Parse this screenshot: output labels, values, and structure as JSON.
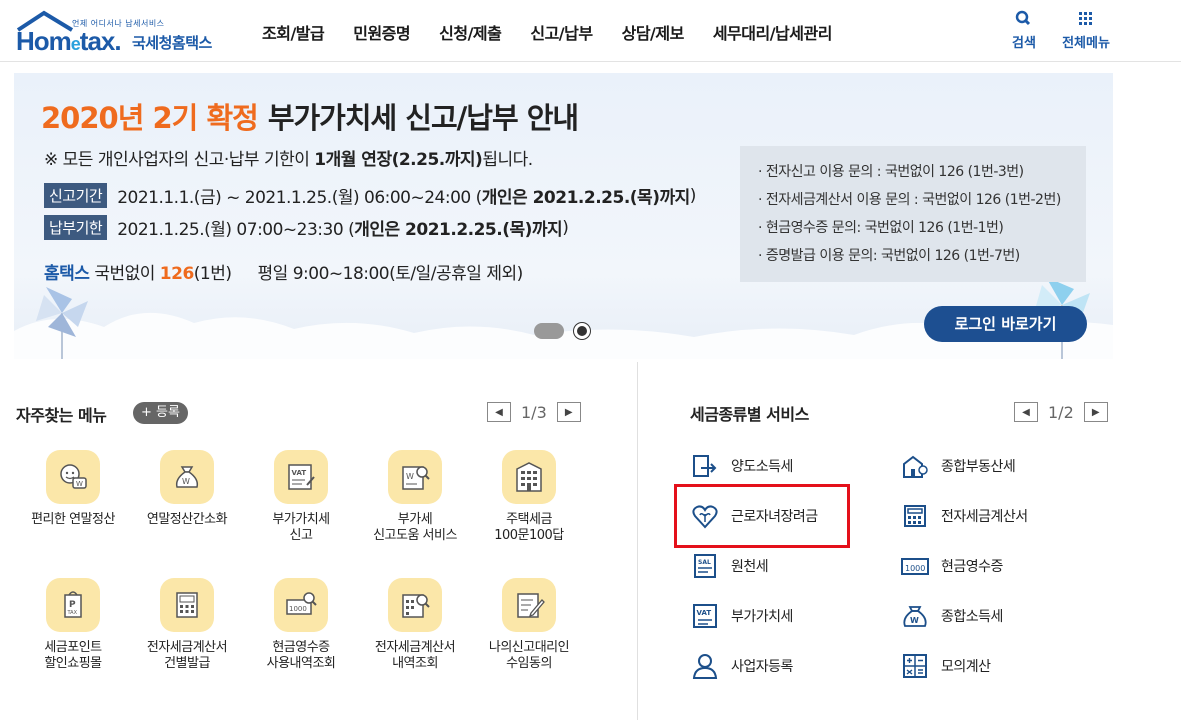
{
  "header": {
    "logo_sub": "언제 어디서나 납세서비스",
    "logo_word_a": "Hom",
    "logo_word_e": "e",
    "logo_word_b": "tax.",
    "logo_kr": "국세청홈택스",
    "nav": [
      "조회/발급",
      "민원증명",
      "신청/제출",
      "신고/납부",
      "상담/제보",
      "세무대리/납세관리"
    ],
    "search_label": "검색",
    "menu_label": "전체메뉴",
    "accent_color": "#1c5aa8"
  },
  "banner": {
    "title_orange": "2020년 2기 확정",
    "title_dark": "부가가치세 신고/납부 안내",
    "note_a": "※ 모든 개인사업자의 신고·납부 기한이 ",
    "note_b": "1개월 연장(2.25.까지)",
    "note_c": "됩니다.",
    "filing_tag": "신고기간",
    "filing_text": "2021.1.1.(금) ~ 2021.1.25.(월) 06:00~24:00 (",
    "filing_bold": "개인은 2021.2.25.(목)까지",
    "filing_end": ")",
    "payment_tag": "납부기한",
    "payment_text": "2021.1.25.(월) 07:00~23:30 (",
    "payment_bold": "개인은 2021.2.25.(목)까지",
    "payment_end": ")",
    "contact_brand": "홈택스",
    "contact_text": " 국번없이 ",
    "contact_number": "126",
    "contact_suffix": "(1번)",
    "hours": "평일 9:00~18:00(토/일/공휴일 제외)",
    "info": [
      "· 전자신고 이용 문의 : 국번없이 126 (1번-3번)",
      "· 전자세금계산서 이용 문의 : 국번없이 126 (1번-2번)",
      "· 현금영수증 문의: 국번없이 126 (1번-1번)",
      "· 증명발급 이용 문의: 국번없이 126 (1번-7번)"
    ],
    "login_button": "로그인 바로가기",
    "accent_orange": "#ef6b1e"
  },
  "favorites": {
    "title": "자주찾는 메뉴",
    "register": "+ 등록",
    "page": "1/3",
    "items": [
      {
        "label": "편리한 연말정산",
        "icon": "year-end-settlement-icon"
      },
      {
        "label": "연말정산간소화",
        "icon": "money-bag-icon"
      },
      {
        "label": "부가가치세\n신고",
        "icon": "vat-document-icon"
      },
      {
        "label": "부가세\n신고도움 서비스",
        "icon": "vat-help-icon"
      },
      {
        "label": "주택세금\n100문100답",
        "icon": "building-icon"
      },
      {
        "label": "세금포인트\n할인쇼핑몰",
        "icon": "tax-point-icon"
      },
      {
        "label": "전자세금계산서\n건별발급",
        "icon": "calculator-icon"
      },
      {
        "label": "현금영수증\n사용내역조회",
        "icon": "cash-receipt-search-icon"
      },
      {
        "label": "전자세금계산서\n내역조회",
        "icon": "invoice-search-icon"
      },
      {
        "label": "나의신고대리인\n수임동의",
        "icon": "edit-document-icon"
      }
    ]
  },
  "services": {
    "title": "세금종류별 서비스",
    "page": "1/2",
    "items": [
      {
        "label": "양도소득세",
        "icon": "transfer-income-icon"
      },
      {
        "label": "종합부동산세",
        "icon": "real-estate-icon"
      },
      {
        "label": "근로자녀장려금",
        "icon": "heart-sprout-icon"
      },
      {
        "label": "전자세금계산서",
        "icon": "e-invoice-icon"
      },
      {
        "label": "원천세",
        "icon": "withholding-icon"
      },
      {
        "label": "현금영수증",
        "icon": "cash-receipt-icon"
      },
      {
        "label": "부가가치세",
        "icon": "vat-icon"
      },
      {
        "label": "종합소득세",
        "icon": "income-tax-icon"
      },
      {
        "label": "사업자등록",
        "icon": "business-registration-icon"
      },
      {
        "label": "모의계산",
        "icon": "mock-calculation-icon"
      }
    ],
    "highlight_color": "#e4101a"
  }
}
